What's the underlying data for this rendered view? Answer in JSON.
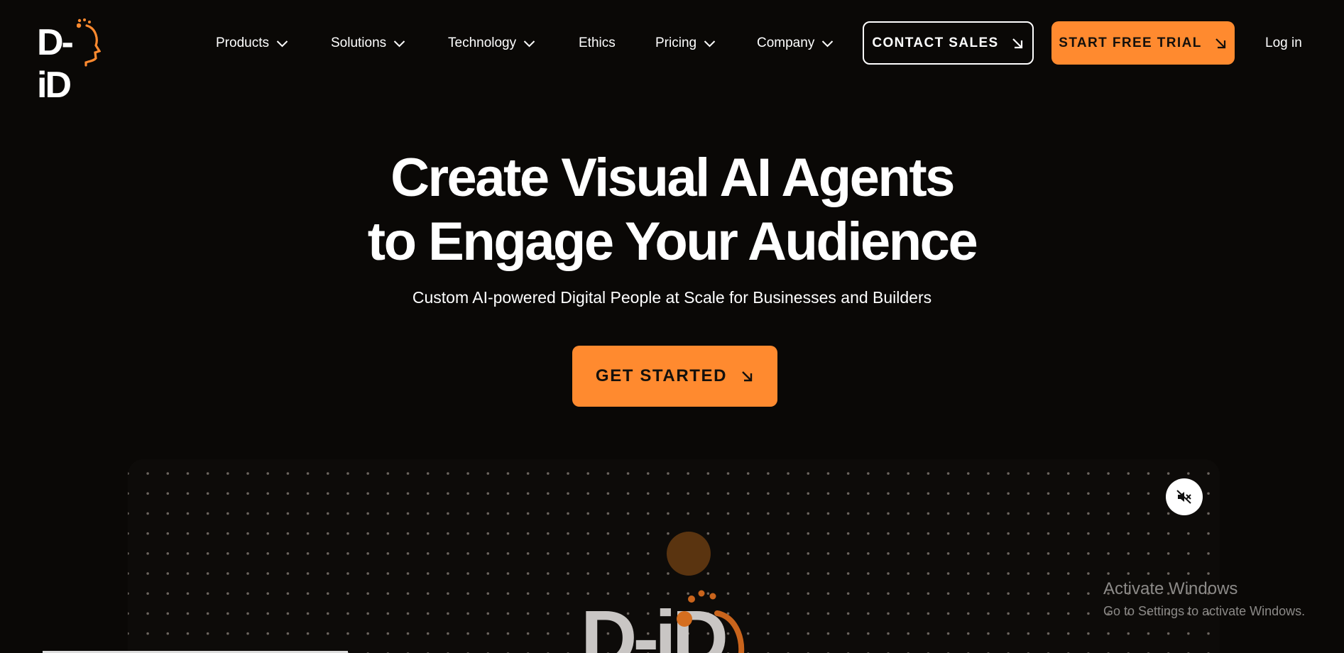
{
  "brand": {
    "logo_text": "D-iD",
    "accent": "#ff8a2f"
  },
  "nav": {
    "items": [
      {
        "label": "Products",
        "dropdown": true
      },
      {
        "label": "Solutions",
        "dropdown": true
      },
      {
        "label": "Technology",
        "dropdown": true
      },
      {
        "label": "Ethics",
        "dropdown": false
      },
      {
        "label": "Pricing",
        "dropdown": true
      },
      {
        "label": "Company",
        "dropdown": true
      }
    ],
    "contact_sales": "CONTACT SALES",
    "start_free_trial": "START FREE TRIAL",
    "login": "Log in"
  },
  "hero": {
    "title_line1": "Create Visual AI Agents",
    "title_line2": "to Engage Your Audience",
    "subtitle": "Custom AI-powered Digital People at Scale for Businesses and Builders",
    "cta": "GET STARTED"
  },
  "video": {
    "mute_icon": "speaker-muted-icon",
    "logo_text": "D-iD"
  },
  "watermark": {
    "title": "Activate Windows",
    "subtitle": "Go to Settings to activate Windows."
  },
  "colors": {
    "background": "#0a0806",
    "accent": "#ff8a2f",
    "text": "#ffffff"
  }
}
